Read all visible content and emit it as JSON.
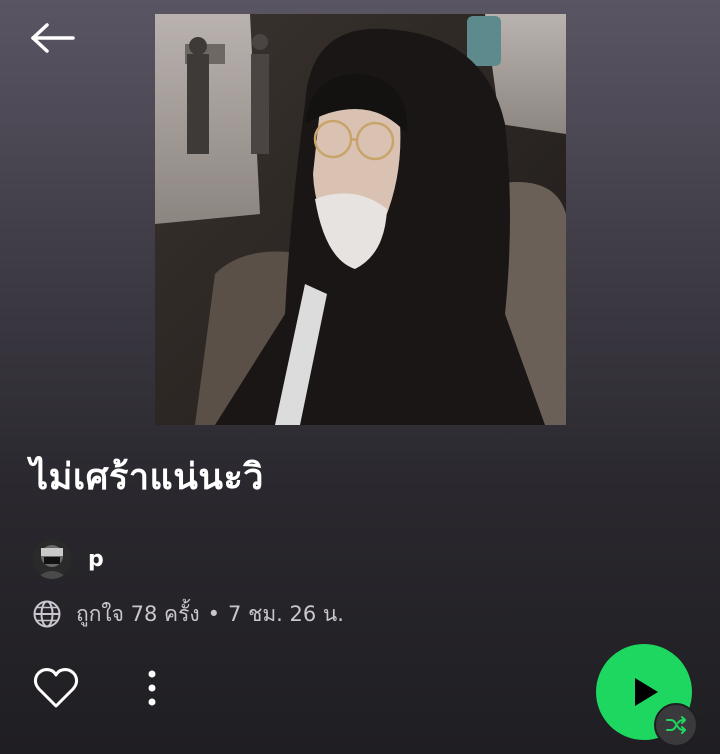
{
  "header": {
    "back_icon": "arrow-left-icon"
  },
  "playlist": {
    "title": "ไม่เศร้าแน่นะวิ",
    "owner": "p",
    "likes_text": "ถูกใจ 78 ครั้ง",
    "separator": "•",
    "duration_text": "7 ชม. 26 น.",
    "visibility_icon": "globe-icon"
  },
  "actions": {
    "like_icon": "heart-outline-icon",
    "more_icon": "more-vertical-icon",
    "play_icon": "play-icon",
    "shuffle_icon": "shuffle-icon"
  },
  "colors": {
    "accent": "#1ed760",
    "background_top": "#5a5563",
    "background_bottom": "#1f1e22",
    "secondary_text": "#c9c6cf"
  }
}
